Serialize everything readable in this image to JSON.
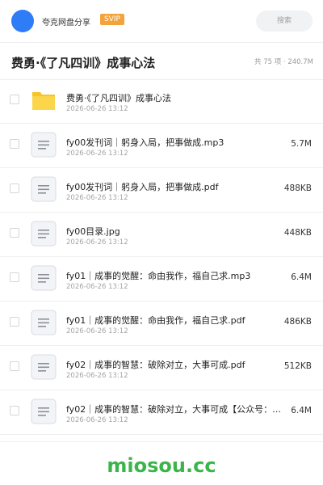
{
  "header": {
    "app_name": "夸克网盘分享",
    "badge": "SVIP",
    "search_placeholder": "搜索"
  },
  "folder": {
    "title": "费勇·《了凡四训》成事心法",
    "summary": "共 75 项 · 240.7M"
  },
  "files": [
    {
      "name": "费勇·《了凡四训》成事心法",
      "date": "2026-06-26 13:12",
      "size": "",
      "icon": "folder-icon"
    },
    {
      "name": "fy00发刊词｜躬身入局，把事做成.mp3",
      "date": "2026-06-26 13:12",
      "size": "5.7M",
      "icon": "document-icon"
    },
    {
      "name": "fy00发刊词｜躬身入局，把事做成.pdf",
      "date": "2026-06-26 13:12",
      "size": "488KB",
      "icon": "document-icon"
    },
    {
      "name": "fy00目录.jpg",
      "date": "2026-06-26 13:12",
      "size": "448KB",
      "icon": "document-icon"
    },
    {
      "name": "fy01｜成事的觉醒：命由我作，福自己求.mp3",
      "date": "2026-06-26 13:12",
      "size": "6.4M",
      "icon": "document-icon"
    },
    {
      "name": "fy01｜成事的觉醒：命由我作，福自己求.pdf",
      "date": "2026-06-26 13:12",
      "size": "486KB",
      "icon": "document-icon"
    },
    {
      "name": "fy02｜成事的智慧：破除对立，大事可成.pdf",
      "date": "2026-06-26 13:12",
      "size": "512KB",
      "icon": "document-icon"
    },
    {
      "name": "fy02｜成事的智慧：破除对立，大事可成【公众号：…",
      "date": "2026-06-26 13:12",
      "size": "6.4M",
      "icon": "document-icon"
    }
  ],
  "watermark": "miosou.cc",
  "colors": {
    "accent": "#2e7cf6",
    "badge": "#f3a33b",
    "folder": "#f7c325",
    "watermark": "#3bb54a"
  }
}
